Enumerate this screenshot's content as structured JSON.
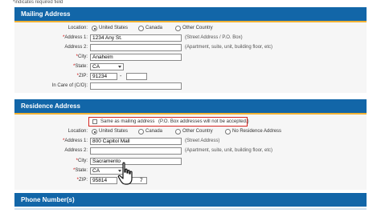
{
  "required_note": "*indicates required field",
  "mailing": {
    "title": "Mailing Address",
    "location_label": "Location:",
    "location_options": [
      "United States",
      "Canada",
      "Other Country"
    ],
    "location_selected": "United States",
    "address1_label": "Address 1:",
    "address1_value": "1234 Any St.",
    "address1_hint": "(Street Address / P.O. Box)",
    "address2_label": "Address 2:",
    "address2_value": "",
    "address2_hint": "(Apartment, suite, unit, building floor, etc)",
    "city_label": "City:",
    "city_value": "Anaheim",
    "state_label": "State:",
    "state_value": "CA",
    "zip_label": "ZIP:",
    "zip_value": "91234",
    "zip_ext_value": "",
    "zip_dash": "-",
    "care_of_label": "In Care of (C/O):",
    "care_of_value": ""
  },
  "residence": {
    "title": "Residence Address",
    "same_as_label": "Same as mailing address",
    "same_as_note": "(P.O. Box addresses will not be accepted.)",
    "location_label": "Location:",
    "location_options": [
      "United States",
      "Canada",
      "Other Country",
      "No Residence Address"
    ],
    "location_selected": "United States",
    "address1_label": "Address 1:",
    "address1_value": "800 Capitol Mall",
    "address1_hint": "(Street Address)",
    "address2_label": "Address 2:",
    "address2_value": "",
    "address2_hint": "(Apartment, suite, unit, building floor, etc)",
    "city_label": "City:",
    "city_value": "Sacramento",
    "state_label": "State:",
    "state_value": "CA",
    "zip_label": "ZIP:",
    "zip_value": "95814",
    "zip_ext_value": "7",
    "zip_dash": "-"
  },
  "phone": {
    "title": "Phone Number(s)"
  },
  "req_star": "*",
  "colors": {
    "section_bar": "#1266a8",
    "section_bar_edge": "#f2b233",
    "required_star": "#cc0000",
    "highlight_border": "#d4241f"
  }
}
